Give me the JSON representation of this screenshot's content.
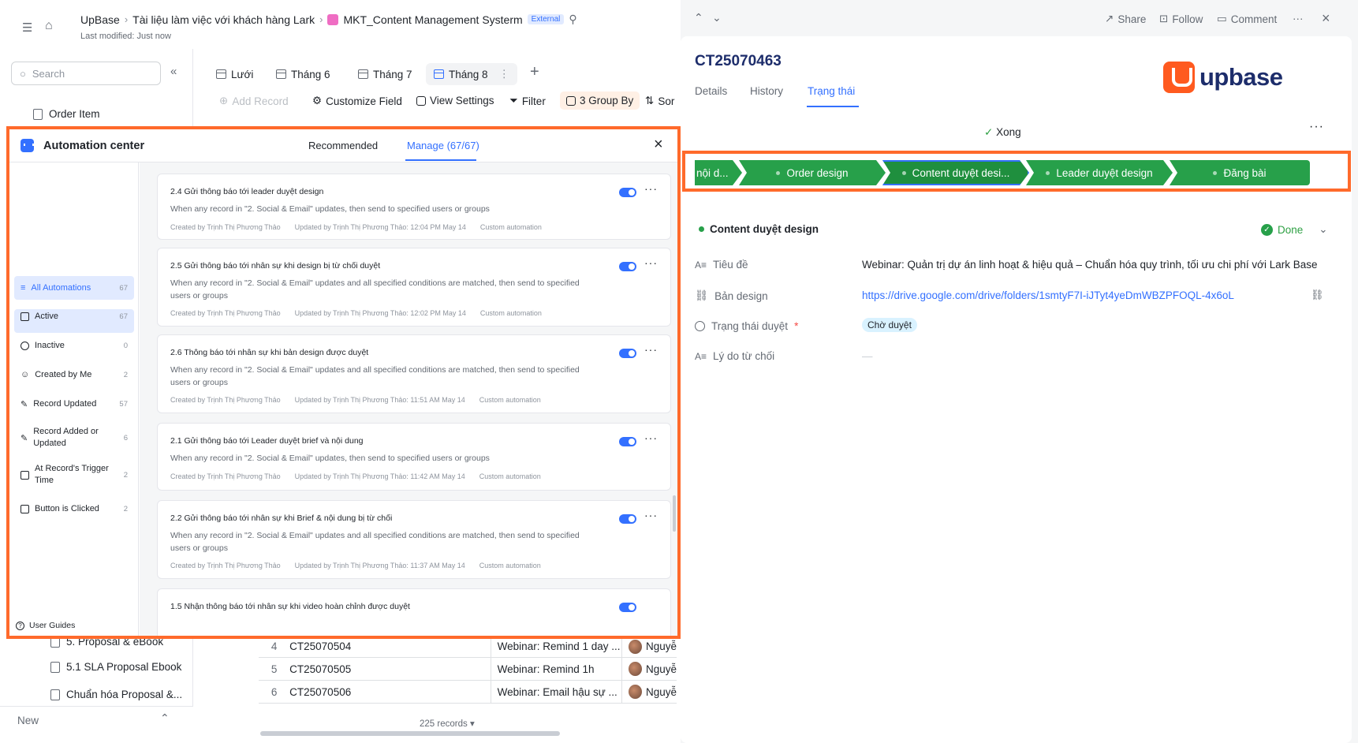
{
  "header": {
    "breadcrumbs": [
      "UpBase",
      "Tài liệu làm việc với khách hàng Lark",
      "MKT_Content Management Systerm"
    ],
    "external_badge": "External",
    "last_modified": "Last modified: Just now"
  },
  "sidebar": {
    "search_placeholder": "Search",
    "items_top": [
      "Order Item"
    ],
    "items_bottom": [
      "5. Proposal & eBook",
      "5.1 SLA Proposal Ebook",
      "Chuẩn hóa Proposal &..."
    ],
    "new_label": "New"
  },
  "view_tabs": [
    "Lưới",
    "Tháng 6",
    "Tháng 7",
    "Tháng 8"
  ],
  "toolbar": {
    "add_record": "Add Record",
    "customize_field": "Customize Field",
    "view_settings": "View Settings",
    "filter": "Filter",
    "group_by": "3 Group By",
    "sort": "Sor"
  },
  "table_rows": [
    {
      "num": "4",
      "id": "CT25070504",
      "text": "Webinar: Remind 1 day ...",
      "user": "Nguyễ"
    },
    {
      "num": "5",
      "id": "CT25070505",
      "text": "Webinar: Remind 1h",
      "user": "Nguyễ"
    },
    {
      "num": "6",
      "id": "CT25070506",
      "text": "Webinar: Email hậu sự ...",
      "user": "Nguyễ"
    }
  ],
  "records_count": "225 records",
  "automation": {
    "title": "Automation center",
    "tabs": [
      "Recommended",
      "Manage (67/67)"
    ],
    "nav": [
      {
        "label": "All Automations",
        "count": "67"
      },
      {
        "label": "Active",
        "count": "67"
      },
      {
        "label": "Inactive",
        "count": "0"
      },
      {
        "label": "Created by Me",
        "count": "2"
      },
      {
        "label": "Record Updated",
        "count": "57"
      },
      {
        "label": "Record Added or Updated",
        "count": "6"
      },
      {
        "label": "At Record's Trigger Time",
        "count": "2"
      },
      {
        "label": "Button is Clicked",
        "count": "2"
      }
    ],
    "user_guides": "User Guides",
    "cards": [
      {
        "title": "2.4 Gửi thông báo tới leader duyệt design",
        "desc": "When any record in \"2. Social & Email\" updates, then send to specified users or groups",
        "created": "Created by Trịnh Thị Phương Thảo",
        "updated": "Updated by Trịnh Thị Phương Thảo: 12:04 PM May 14",
        "type": "Custom automation"
      },
      {
        "title": "2.5 Gửi thông báo tới nhân sự khi design bị từ chối duyệt",
        "desc": "When any record in \"2. Social & Email\" updates and all specified conditions are matched, then send to specified users or groups",
        "created": "Created by Trịnh Thị Phương Thảo",
        "updated": "Updated by Trịnh Thị Phương Thảo: 12:02 PM May 14",
        "type": "Custom automation"
      },
      {
        "title": "2.6 Thông báo tới nhân sự khi bản design được duyệt",
        "desc": "When any record in \"2. Social & Email\" updates and all specified conditions are matched, then send to specified users or groups",
        "created": "Created by Trịnh Thị Phương Thảo",
        "updated": "Updated by Trịnh Thị Phương Thảo: 11:51 AM May 14",
        "type": "Custom automation"
      },
      {
        "title": "2.1 Gửi thông báo tới Leader duyệt brief và nội dung",
        "desc": "When any record in \"2. Social & Email\" updates, then send to specified users or groups",
        "created": "Created by Trịnh Thị Phương Thảo",
        "updated": "Updated by Trịnh Thị Phương Thảo: 11:42 AM May 14",
        "type": "Custom automation"
      },
      {
        "title": "2.2 Gửi thông báo tới nhân sự khi Brief & nội dung bị từ chối",
        "desc": "When any record in \"2. Social & Email\" updates and all specified conditions are matched, then send to specified users or groups",
        "created": "Created by Trịnh Thị Phương Thảo",
        "updated": "Updated by Trịnh Thị Phương Thảo: 11:37 AM May 14",
        "type": "Custom automation"
      }
    ],
    "partial_card_title": "1.5 Nhận thông báo tới nhân sự khi video hoàn chỉnh được duyệt"
  },
  "record": {
    "actions": {
      "share": "Share",
      "follow": "Follow",
      "comment": "Comment"
    },
    "id": "CT25070463",
    "tabs": [
      "Details",
      "History",
      "Trạng thái"
    ],
    "logo_text": "upbase",
    "status": "Xong",
    "stages": [
      "nội d...",
      "Order design",
      "Content duyệt desi...",
      "Leader duyệt design",
      "Đăng bài"
    ],
    "current_stage": "Content duyệt design",
    "stage_status": "Done",
    "fields": [
      {
        "label": "Tiêu đề",
        "value": "Webinar: Quản trị dự án linh hoạt & hiệu quả – Chuẩn hóa quy trình, tối ưu chi phí với Lark Base"
      },
      {
        "label": "Bản design",
        "value": "https://drive.google.com/drive/folders/1smtyF7I-iJTyt4yeDmWBZPFOQL-4x6oL"
      },
      {
        "label": "Trạng thái duyệt",
        "value": "Chờ duyệt"
      },
      {
        "label": "Lý do từ chối",
        "value": "—"
      }
    ]
  },
  "colors": {
    "accent": "#3370ff",
    "stage_green": "#27a04a",
    "highlight": "#ff6a2b",
    "logo": "#ff5a1f"
  }
}
